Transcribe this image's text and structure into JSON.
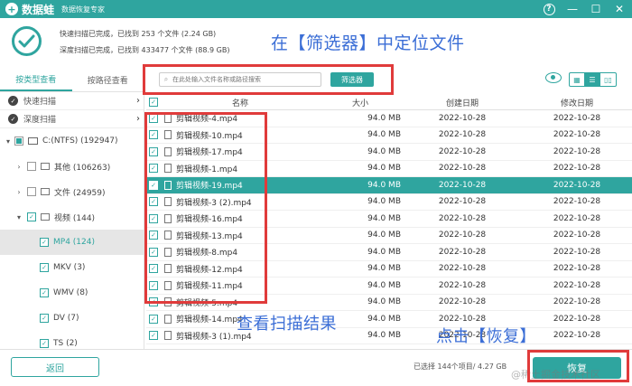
{
  "app": {
    "logo_glyph": "+",
    "name": "数据蛙",
    "subtitle": "数据恢复专家",
    "controls": {
      "help": "?",
      "minimize": "—",
      "maximize": "☐",
      "close": "✕"
    }
  },
  "summary": {
    "quick_scan": "快速扫描已完成，已找到 253 个文件 (2.24 GB)",
    "deep_scan": "深度扫描已完成，已找到 433477 个文件 (88.9 GB)"
  },
  "annotations": {
    "locate": "在【筛选器】中定位文件",
    "view_results": "查看扫描结果",
    "click_recover": "点击【恢复】"
  },
  "view_tabs": [
    "按类型查看",
    "按路径查看"
  ],
  "scan_modes": [
    {
      "label": "快速扫描",
      "arrow": "›"
    },
    {
      "label": "深度扫描",
      "arrow": "›"
    }
  ],
  "tree": [
    {
      "arrow": "▾",
      "label": "C:(NTFS) (192947)"
    },
    {
      "arrow": "›",
      "label": "其他 (106263)"
    },
    {
      "arrow": "›",
      "label": "文件 (24959)"
    },
    {
      "arrow": "▾",
      "label": "视频 (144)"
    },
    {
      "label": "MP4 (124)"
    },
    {
      "label": "MKV (3)"
    },
    {
      "label": "WMV (8)"
    },
    {
      "label": "DV (7)"
    },
    {
      "label": "TS (2)"
    }
  ],
  "search": {
    "placeholder": "在此处输入文件名称或路径搜索",
    "icon": "search-icon"
  },
  "filter_button": "筛选器",
  "view_buttons": [
    "▦",
    "☰",
    "▯▯"
  ],
  "table": {
    "columns": {
      "name": "名称",
      "size": "大小",
      "created": "创建日期",
      "modified": "修改日期"
    },
    "rows": [
      {
        "name": "剪辑视频-4.mp4",
        "size": "94.0 MB",
        "created": "2022-10-28",
        "modified": "2022-10-28"
      },
      {
        "name": "剪辑视频-10.mp4",
        "size": "94.0 MB",
        "created": "2022-10-28",
        "modified": "2022-10-28"
      },
      {
        "name": "剪辑视频-17.mp4",
        "size": "94.0 MB",
        "created": "2022-10-28",
        "modified": "2022-10-28"
      },
      {
        "name": "剪辑视频-1.mp4",
        "size": "94.0 MB",
        "created": "2022-10-28",
        "modified": "2022-10-28"
      },
      {
        "name": "剪辑视频-19.mp4",
        "size": "94.0 MB",
        "created": "2022-10-28",
        "modified": "2022-10-28"
      },
      {
        "name": "剪辑视频-3 (2).mp4",
        "size": "94.0 MB",
        "created": "2022-10-28",
        "modified": "2022-10-28"
      },
      {
        "name": "剪辑视频-16.mp4",
        "size": "94.0 MB",
        "created": "2022-10-28",
        "modified": "2022-10-28"
      },
      {
        "name": "剪辑视频-13.mp4",
        "size": "94.0 MB",
        "created": "2022-10-28",
        "modified": "2022-10-28"
      },
      {
        "name": "剪辑视频-8.mp4",
        "size": "94.0 MB",
        "created": "2022-10-28",
        "modified": "2022-10-28"
      },
      {
        "name": "剪辑视频-12.mp4",
        "size": "94.0 MB",
        "created": "2022-10-28",
        "modified": "2022-10-28"
      },
      {
        "name": "剪辑视频-11.mp4",
        "size": "94.0 MB",
        "created": "2022-10-28",
        "modified": "2022-10-28"
      },
      {
        "name": "剪辑视频-5.mp4",
        "size": "94.0 MB",
        "created": "2022-10-28",
        "modified": "2022-10-28"
      },
      {
        "name": "剪辑视频-14.mp4",
        "size": "94.0 MB",
        "created": "2022-10-28",
        "modified": "2022-10-28"
      },
      {
        "name": "剪辑视频-3 (1).mp4",
        "size": "94.0 MB",
        "created": "2022-10-28",
        "modified": "2022-10-28"
      }
    ]
  },
  "bottom": {
    "back": "返回",
    "selected_info": "已选择 144个项目/ 4.27 GB",
    "recover": "恢复",
    "watermark": "@稀土掘金技术社区"
  },
  "colors": {
    "accent": "#2fa59f",
    "annotation_text": "#3b6ed6",
    "annotation_box": "#e03b3b"
  }
}
